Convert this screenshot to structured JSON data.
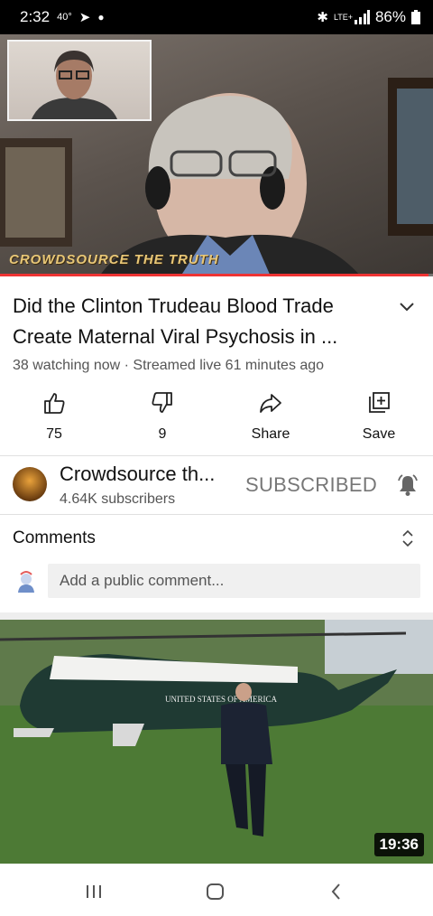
{
  "status_bar": {
    "time": "2:32",
    "temperature": "40°",
    "lte": "LTE+",
    "battery": "86%"
  },
  "video": {
    "watermark": "CROWDSOURCE THE TRUTH",
    "progress": 0.99
  },
  "video_info": {
    "title": "Did the Clinton Trudeau Blood Trade Create Maternal Viral Psychosis in ...",
    "meta": "38 watching now · Streamed live 61 minutes ago"
  },
  "actions": [
    {
      "label": "75",
      "icon": "thumbs-up-icon"
    },
    {
      "label": "9",
      "icon": "thumbs-down-icon"
    },
    {
      "label": "Share",
      "icon": "share-icon"
    },
    {
      "label": "Save",
      "icon": "save-playlist-icon"
    }
  ],
  "channel": {
    "name": "Crowdsource th...",
    "subscribers": "4.64K subscribers",
    "subscribe_label": "SUBSCRIBED"
  },
  "comments": {
    "heading": "Comments",
    "placeholder": "Add a public comment..."
  },
  "next_video": {
    "duration": "19:36",
    "helicopter_text": "UNITED STATES OF AMERICA"
  },
  "colors": {
    "progress": "#ee3333",
    "subscribed": "#777777"
  }
}
